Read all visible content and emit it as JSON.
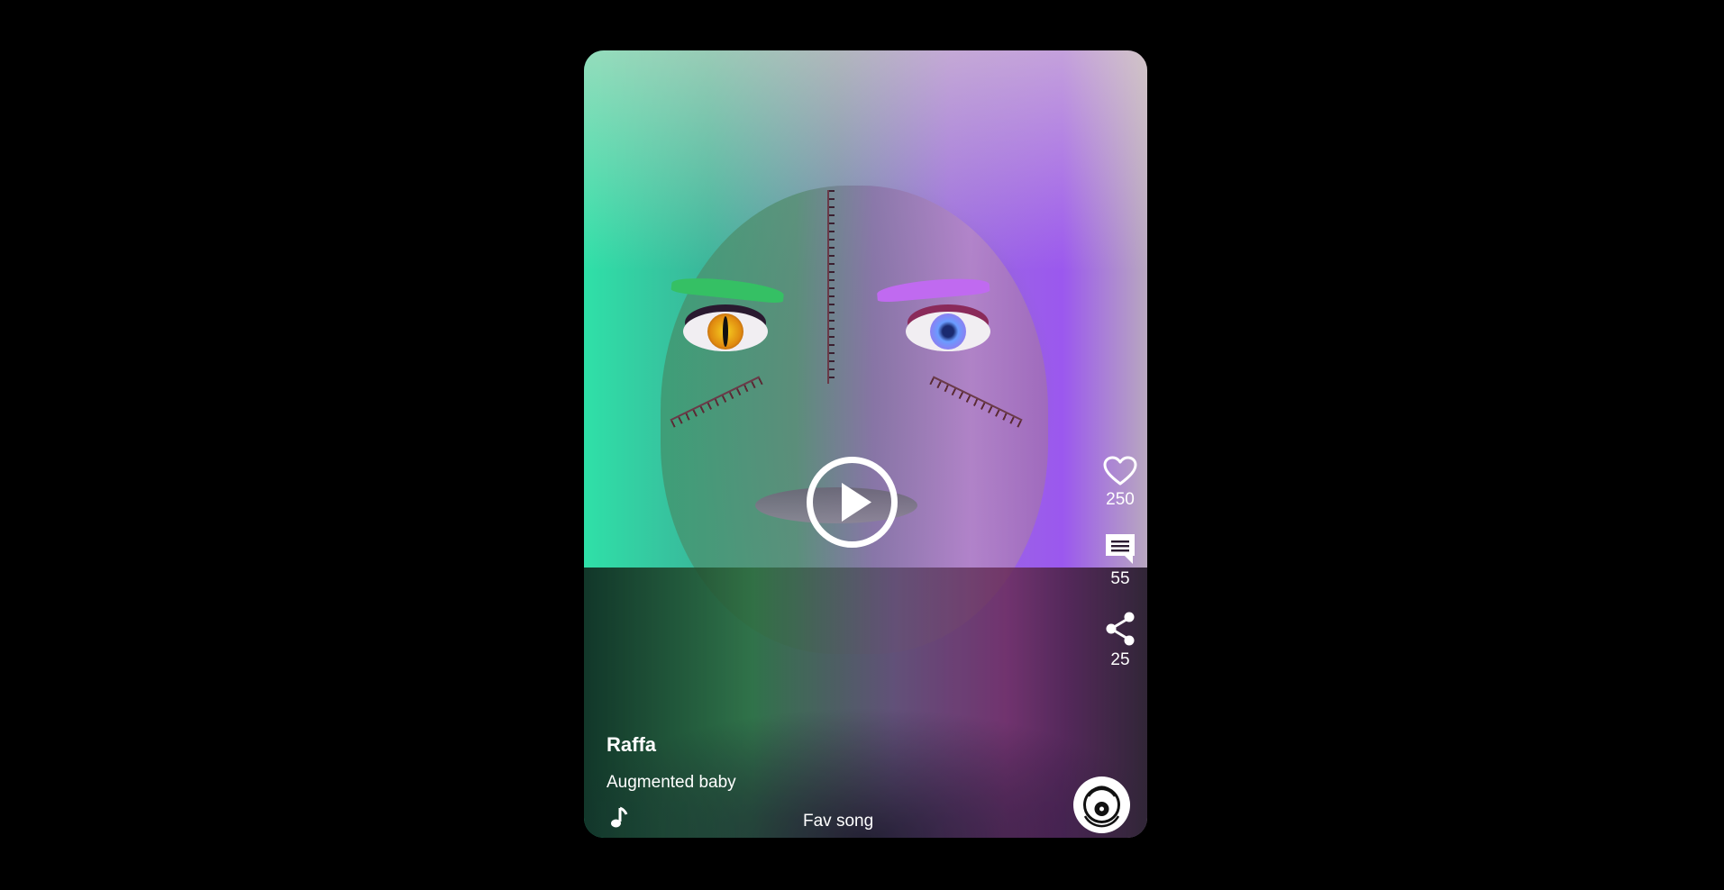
{
  "video": {
    "username": "Raffa",
    "caption": "Augmented baby",
    "song": "Fav song"
  },
  "actions": {
    "likes": "250",
    "comments": "55",
    "shares": "25"
  },
  "icons": {
    "play": "play-icon",
    "like": "heart-icon",
    "comment": "comment-icon",
    "share": "share-icon",
    "music": "music-note-icon",
    "disc": "vinyl-disc-icon"
  },
  "colors": {
    "background": "#000000",
    "text": "#ffffff"
  }
}
